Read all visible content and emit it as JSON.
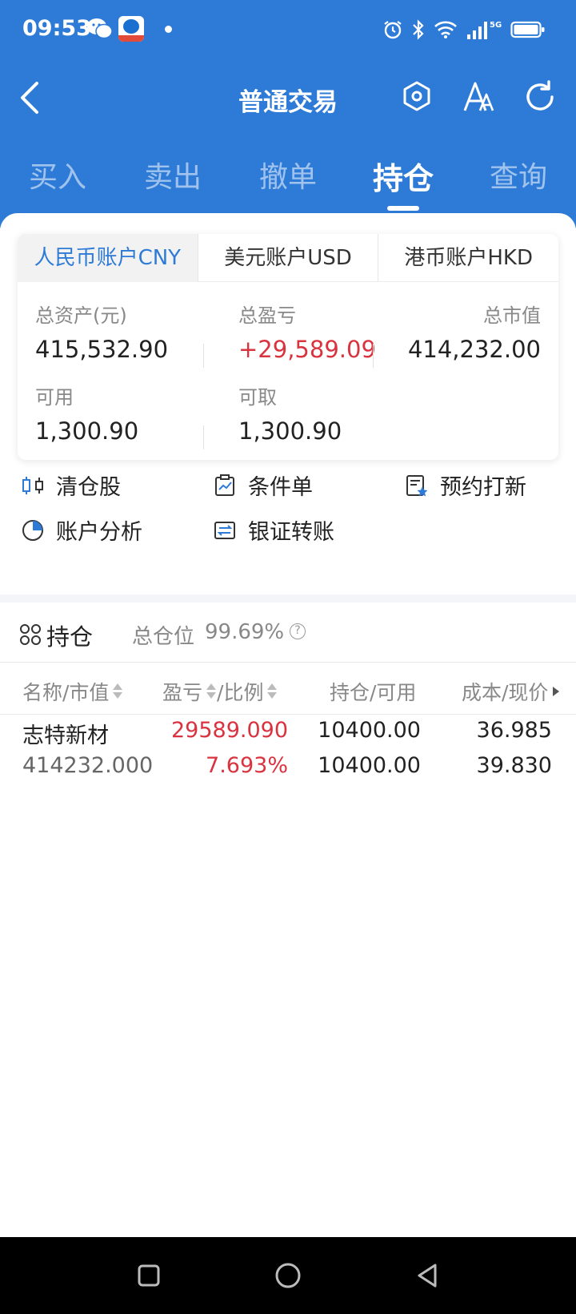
{
  "status_bar": {
    "time": "09:53",
    "icons": [
      "wechat-icon",
      "app-notification-icon",
      "alarm-icon",
      "bluetooth-icon",
      "wifi-icon",
      "signal-5g-icon",
      "battery-icon"
    ],
    "network_label": "5G"
  },
  "nav": {
    "title": "普通交易",
    "icons": [
      "back-icon",
      "hexagon-settings-icon",
      "font-size-icon",
      "refresh-icon"
    ]
  },
  "tabs": [
    "买入",
    "卖出",
    "撤单",
    "持仓",
    "查询"
  ],
  "active_tab": "持仓",
  "accounts": {
    "tabs": [
      "人民币账户CNY",
      "美元账户USD",
      "港币账户HKD"
    ],
    "active": "人民币账户CNY",
    "metrics": {
      "total_assets_label": "总资产(元)",
      "total_assets": "415,532.90",
      "total_pnl_label": "总盈亏",
      "total_pnl": "+29,589.09",
      "market_value_label": "总市值",
      "market_value": "414,232.00",
      "available_label": "可用",
      "available": "1,300.90",
      "withdrawable_label": "可取",
      "withdrawable": "1,300.90"
    }
  },
  "actions": [
    {
      "label": "清仓股",
      "icon": "clear-stock-icon"
    },
    {
      "label": "条件单",
      "icon": "conditional-order-icon"
    },
    {
      "label": "预约打新",
      "icon": "ipo-booking-icon"
    },
    {
      "label": "账户分析",
      "icon": "pie-chart-icon"
    },
    {
      "label": "银证转账",
      "icon": "bank-transfer-icon"
    }
  ],
  "holdings": {
    "title": "持仓",
    "position_label": "总仓位",
    "position_value": "99.69%",
    "columns": [
      "名称/市值",
      "盈亏",
      "/比例",
      "持仓/可用",
      "成本/现价"
    ],
    "rows": [
      {
        "name": "志特新材",
        "market_value": "414232.000",
        "pnl": "29589.090",
        "ratio": "7.693%",
        "holding": "10400.00",
        "available": "10400.00",
        "cost": "36.985",
        "price": "39.830"
      }
    ]
  },
  "colors": {
    "brand_blue": "#2e7bd7",
    "profit_red": "#d9333f"
  }
}
